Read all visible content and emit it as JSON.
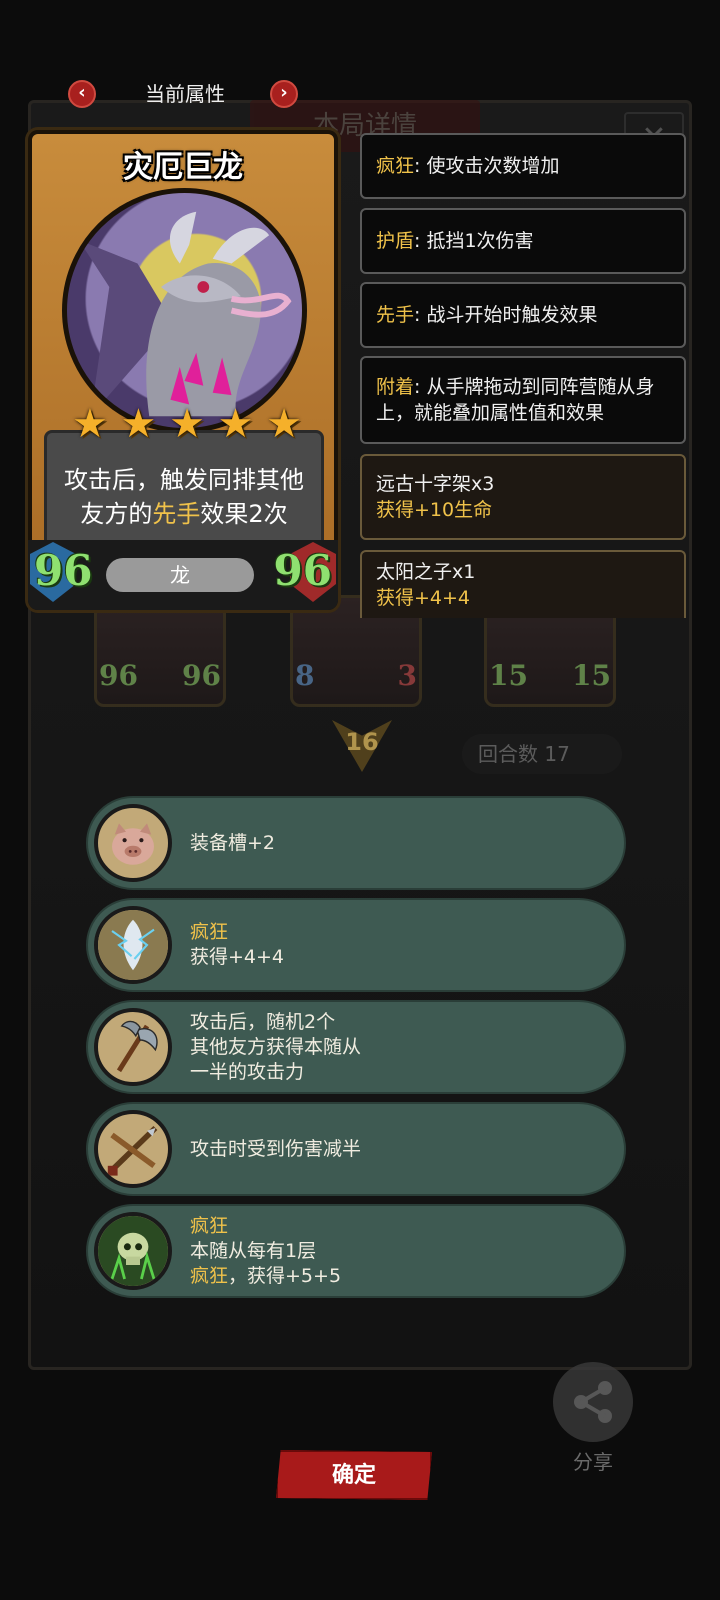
{
  "header": {
    "title": "当前属性"
  },
  "backdrop": {
    "title": "本局详情",
    "mini_cards": [
      {
        "atk": "96",
        "hp": "96"
      },
      {
        "atk": "8",
        "hp": "3"
      },
      {
        "atk": "15",
        "hp": "15"
      }
    ],
    "round_badge": "16",
    "round_label": "回合数 17"
  },
  "card": {
    "name": "灾厄巨龙",
    "stars": 5,
    "desc_pre": "攻击后，触发同排其他友方的",
    "desc_keyword": "先手",
    "desc_post": "效果2次",
    "tribe": "龙",
    "attack": "96",
    "health": "96"
  },
  "keywords": [
    {
      "key": "疯狂",
      "text": ": 使攻击次数增加"
    },
    {
      "key": "护盾",
      "text": ": 抵挡1次伤害"
    },
    {
      "key": "先手",
      "text": ": 战斗开始时触发效果"
    },
    {
      "key": "附着",
      "text": ": 从手牌拖动到同阵营随从身上，就能叠加属性值和效果"
    }
  ],
  "items": [
    {
      "name": "远古十字架x3",
      "effect": "获得+10生命"
    },
    {
      "name": "太阳之子x1",
      "effect": "获得+4+4"
    }
  ],
  "effects": [
    {
      "icon": "pig-head-icon",
      "line1_key": "",
      "line1": "装备槽+2",
      "line2": "",
      "line3_key": "",
      "line3": ""
    },
    {
      "icon": "lightning-crystal-icon",
      "line1_key": "疯狂",
      "line1": "",
      "line2": "获得+4+4",
      "line3_key": "",
      "line3": ""
    },
    {
      "icon": "battle-axe-icon",
      "line1_key": "",
      "line1": "攻击后，随机2个",
      "line2": "其他友方获得本随从",
      "line3_key": "",
      "line3": "一半的攻击力"
    },
    {
      "icon": "crossed-arrows-icon",
      "line1_key": "",
      "line1": "攻击时受到伤害减半",
      "line2": "",
      "line3_key": "",
      "line3": ""
    },
    {
      "icon": "green-skull-icon",
      "line1_key": "疯狂",
      "line1": "",
      "line2": "本随从每有1层",
      "line3_key": "疯狂",
      "line3": "，获得+5+5"
    }
  ],
  "footer": {
    "confirm_label": "确定",
    "share_label": "分享"
  },
  "colors": {
    "keyword": "#f0c24a",
    "effect_row": "#3e5a52",
    "confirm": "#a81a1a",
    "stat": "#8fe070"
  }
}
